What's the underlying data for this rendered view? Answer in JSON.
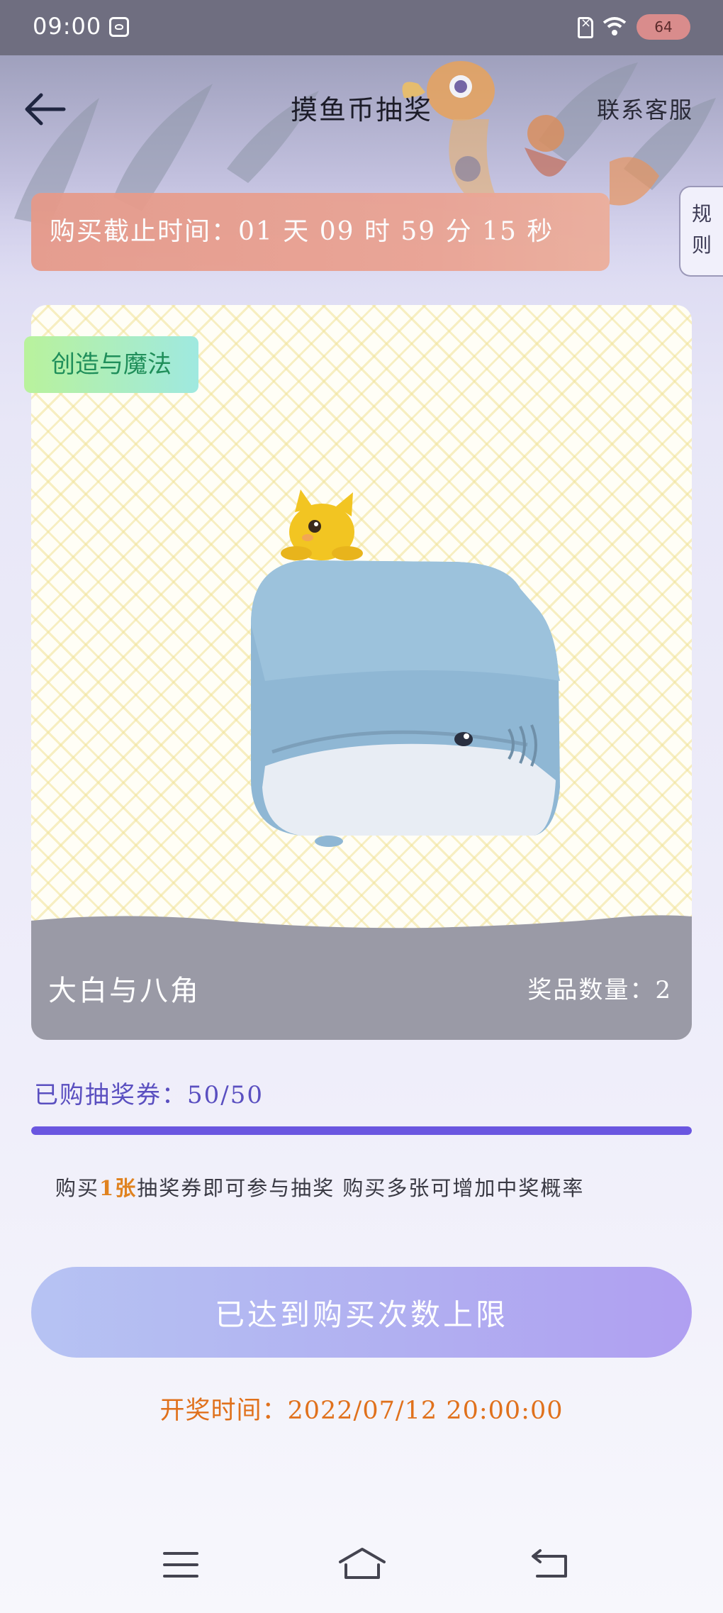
{
  "status_bar": {
    "time": "09:00",
    "battery": "64",
    "icons": [
      "app-icon",
      "sim-icon",
      "wifi-icon",
      "battery-icon"
    ]
  },
  "header": {
    "title": "摸鱼币抽奖",
    "contact": "联系客服",
    "back_icon": "arrow-left-icon"
  },
  "deadline": {
    "text": "购买截止时间：01 天 09 时 59 分 15 秒"
  },
  "rules_tab": {
    "line1": "规",
    "line2": "则"
  },
  "prize": {
    "category": "创造与魔法",
    "name": "大白与八角",
    "quantity_text": "奖品数量：2"
  },
  "tickets": {
    "text": "已购抽奖券：50/50",
    "purchased": 50,
    "total": 50
  },
  "hint": {
    "before": "购买",
    "highlight": "1张",
    "after": "抽奖券即可参与抽奖 购买多张可增加中奖概率"
  },
  "action_button": {
    "label": "已达到购买次数上限"
  },
  "draw_time": {
    "text": "开奖时间：2022/07/12 20:00:00"
  },
  "nav": {
    "icons": [
      "menu-icon",
      "home-icon",
      "back-icon"
    ]
  },
  "colors": {
    "accent": "#6a56e0",
    "highlight": "#e0821f",
    "banner": "#e69a8a"
  }
}
